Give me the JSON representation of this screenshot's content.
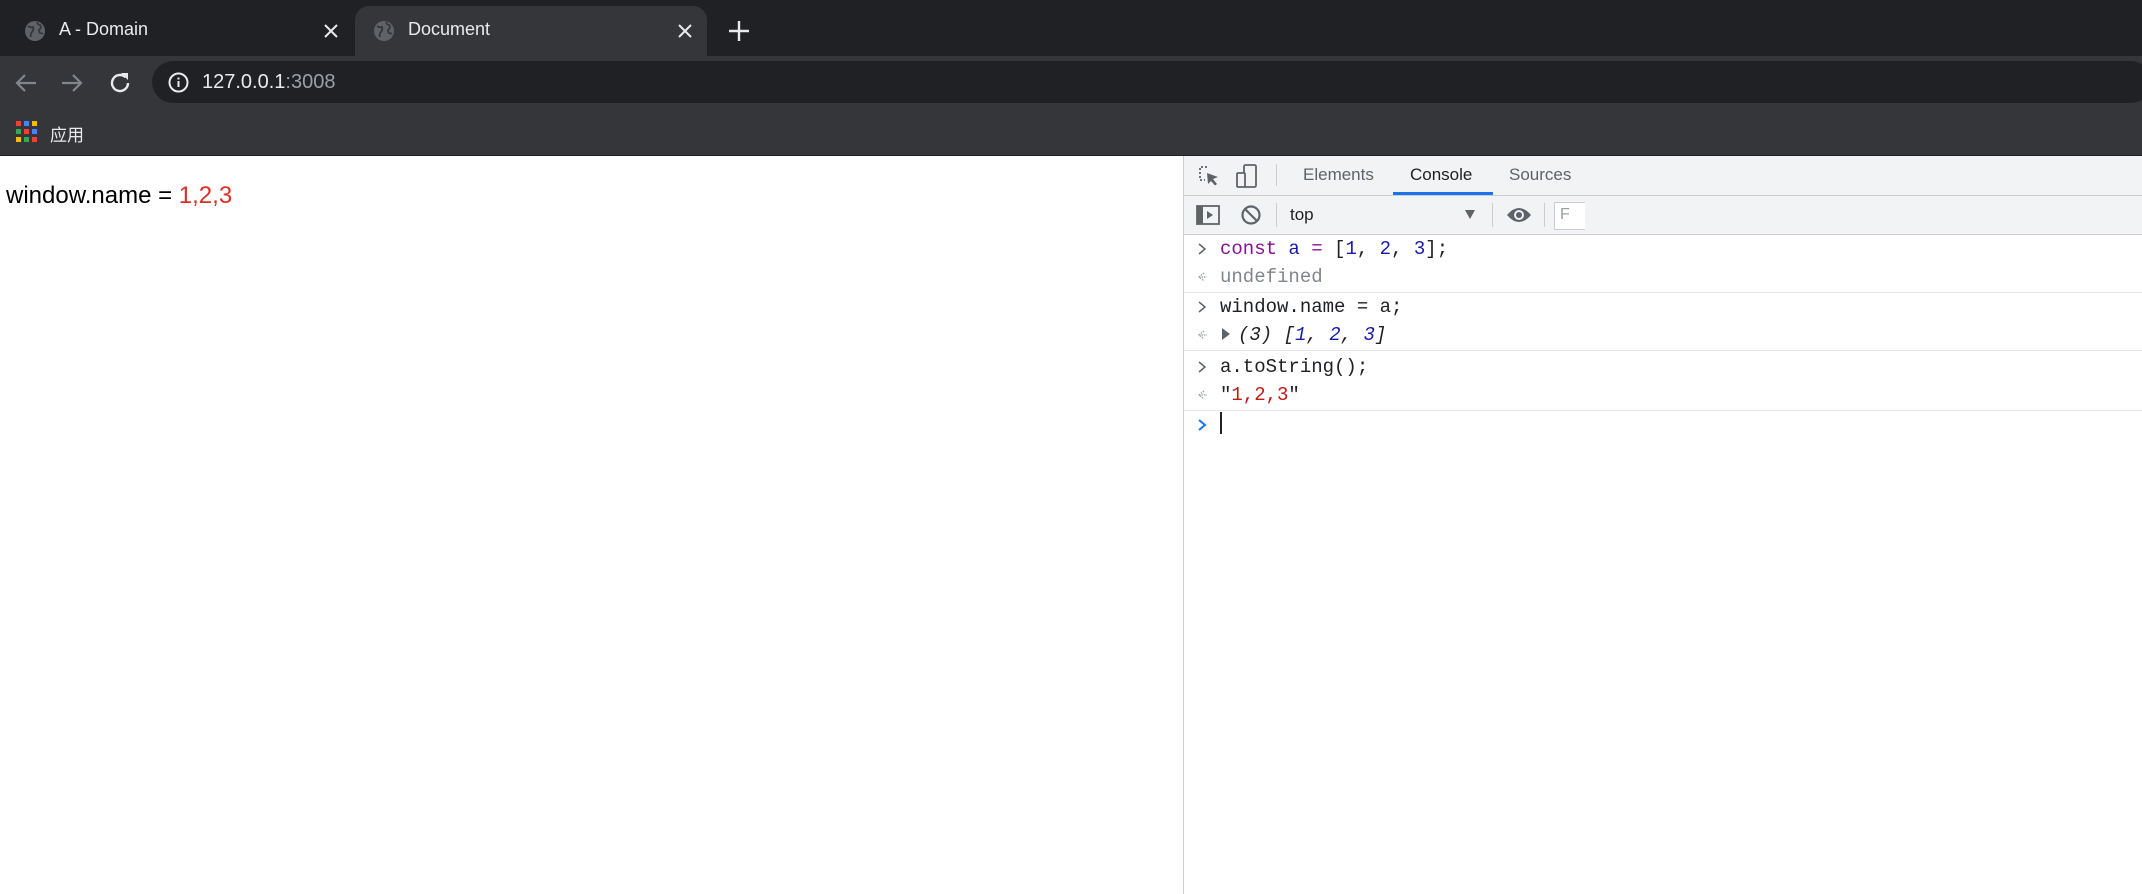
{
  "browser": {
    "tabs": [
      {
        "title": "A - Domain",
        "active": false
      },
      {
        "title": "Document",
        "active": true
      }
    ],
    "address_bar": {
      "host": "127.0.0.1",
      "port": ":3008"
    },
    "bookmarks": [
      {
        "label": "应用",
        "icon": "apps-grid-icon"
      }
    ]
  },
  "page": {
    "label": "window.name = ",
    "value": "1,2,3"
  },
  "devtools": {
    "tabs": [
      "Elements",
      "Console",
      "Sources"
    ],
    "active_tab": "Console",
    "context": "top",
    "filter_placeholder": "F",
    "console": [
      {
        "type": "input",
        "tokens": [
          "const",
          " ",
          "a",
          " ",
          "=",
          " [",
          "1",
          ", ",
          "2",
          ", ",
          "3",
          "];"
        ]
      },
      {
        "type": "output",
        "text": "undefined"
      },
      {
        "type": "input",
        "text": "window.name = a;"
      },
      {
        "type": "output",
        "prefix": "(3) [",
        "items": [
          "1",
          "2",
          "3"
        ],
        "suffix": "]"
      },
      {
        "type": "input",
        "text": "a.toString();"
      },
      {
        "type": "output",
        "quote_open": "\"",
        "string": "1,2,3",
        "quote_close": "\""
      }
    ]
  },
  "colors": {
    "tabstrip_bg": "#202124",
    "toolbar_bg": "#35363a",
    "page_value": "#d93025",
    "devtools_accent": "#1a73e8",
    "keyword": "#881391",
    "number": "#1a1aa6",
    "string": "#c41a16"
  }
}
